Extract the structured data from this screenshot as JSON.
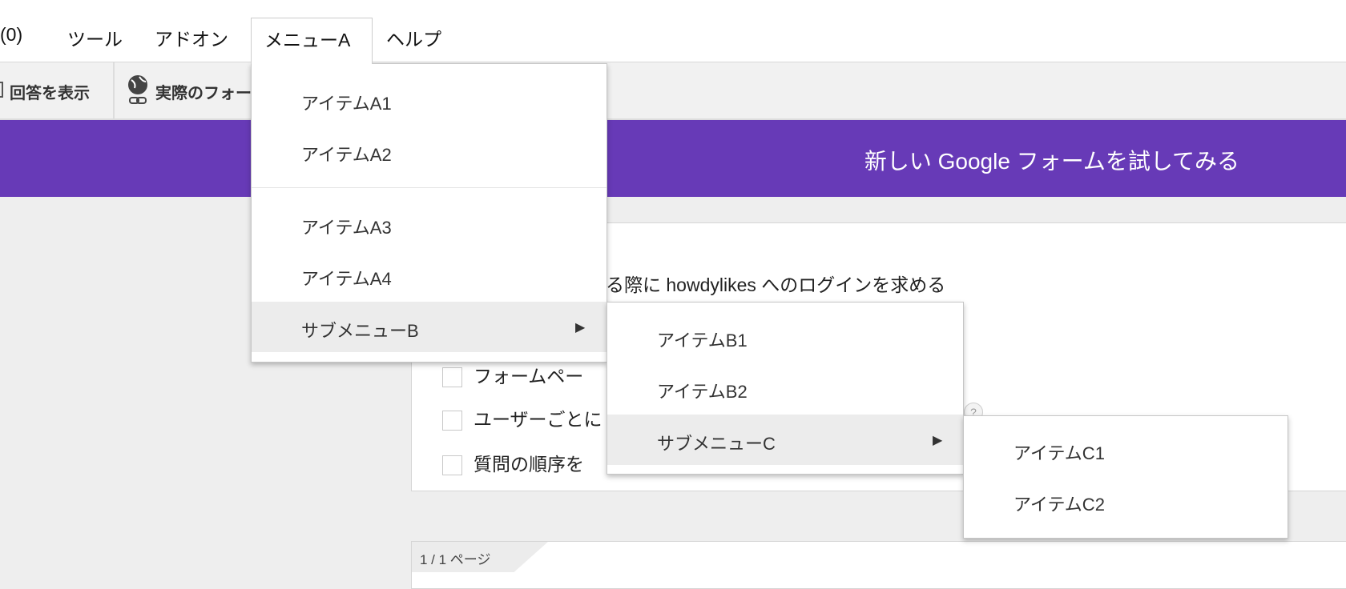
{
  "menubar": {
    "items": [
      "(0)",
      "ツール",
      "アドオン",
      "メニューA",
      "ヘルプ"
    ]
  },
  "toolbar": {
    "responses": "回答を表示",
    "live_form": "実際のフォー"
  },
  "banner": {
    "text": "新しい Google フォームを試してみる"
  },
  "settings": {
    "login_text": "を表示する際に howdylikes へのログインを求める",
    "options": [
      "フォームペー",
      "ユーザーごとに",
      "質問の順序を"
    ]
  },
  "page": {
    "indicator": "1 / 1 ページ"
  },
  "help_icon": "?",
  "menuA": {
    "items": [
      "アイテムA1",
      "アイテムA2",
      "アイテムA3",
      "アイテムA4"
    ],
    "submenu": "サブメニューB"
  },
  "menuB": {
    "items": [
      "アイテムB1",
      "アイテムB2"
    ],
    "submenu": "サブメニューC"
  },
  "menuC": {
    "items": [
      "アイテムC1",
      "アイテムC2"
    ]
  },
  "arrow": "▶"
}
